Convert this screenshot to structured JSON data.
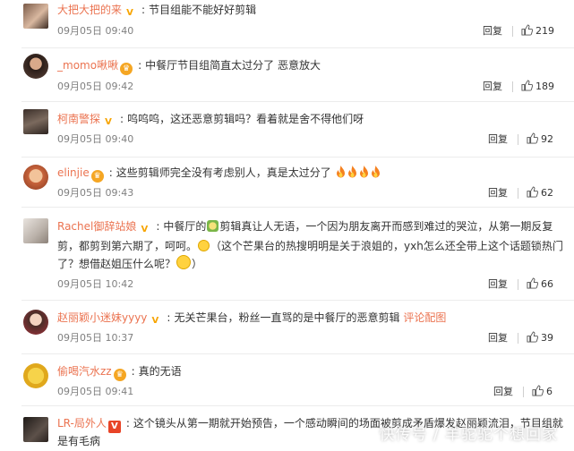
{
  "comments": [
    {
      "user": "大把大把的来",
      "badge": "V",
      "text": "节目组能不能好好剪辑",
      "time": "09月05日 09:40",
      "reply": "回复",
      "likes": "219"
    },
    {
      "user": "_momo啾啾",
      "badge": "crown",
      "text": "中餐厅节目组简直太过分了 恶意放大",
      "time": "09月05日 09:42",
      "reply": "回复",
      "likes": "189"
    },
    {
      "user": "柯南警探",
      "badge": "V",
      "text": "呜呜呜，这还恶意剪辑吗？看着就是舍不得他们呀",
      "time": "09月05日 09:40",
      "reply": "回复",
      "likes": "92"
    },
    {
      "user": "elinjie",
      "badge": "crown",
      "text": "这些剪辑师完全没有考虑别人，真是太过分了",
      "time": "09月05日 09:43",
      "reply": "回复",
      "likes": "62"
    },
    {
      "user": "Rachel御辞站娘",
      "badge": "V",
      "text_line1": "中餐厅的",
      "text_line1b": "剪辑真让人无语，一个因为朋友离开而感到难过的哭泣，从第一期反复",
      "text_line2": "剪，都剪到第六期了，呵呵。",
      "text_line2b": "（这个芒果台的热搜明明是关于浪姐的，yxh怎么还全带上这个话题锁热门",
      "text_line3": "了？想借赵姐压什么呢？",
      "time": "09月05日 10:42",
      "reply": "回复",
      "likes": "66"
    },
    {
      "user": "赵丽颖小迷妹yyyy",
      "badge": "V",
      "text": "无关芒果台，粉丝一直骂的是中餐厅的恶意剪辑",
      "link": "评论配图",
      "time": "09月05日 10:37",
      "reply": "回复",
      "likes": "39"
    },
    {
      "user": "偷喝汽水zz",
      "badge": "crown",
      "text": "真的无语",
      "time": "09月05日 09:41",
      "reply": "回复",
      "likes": "6"
    },
    {
      "user": "LR-局外人",
      "badge": "V",
      "text_line1": "这个镜头从第一期就开始预告，一个感动瞬间的场面被剪成矛盾爆发赵丽颖流泪，节目组就",
      "text_line2": "是有毛病"
    }
  ],
  "watermark": "快传号 / 羊驼驼个想回家",
  "colors": {
    "username": "#eb7350",
    "time": "#808080",
    "v_badge": "#f7a400"
  }
}
